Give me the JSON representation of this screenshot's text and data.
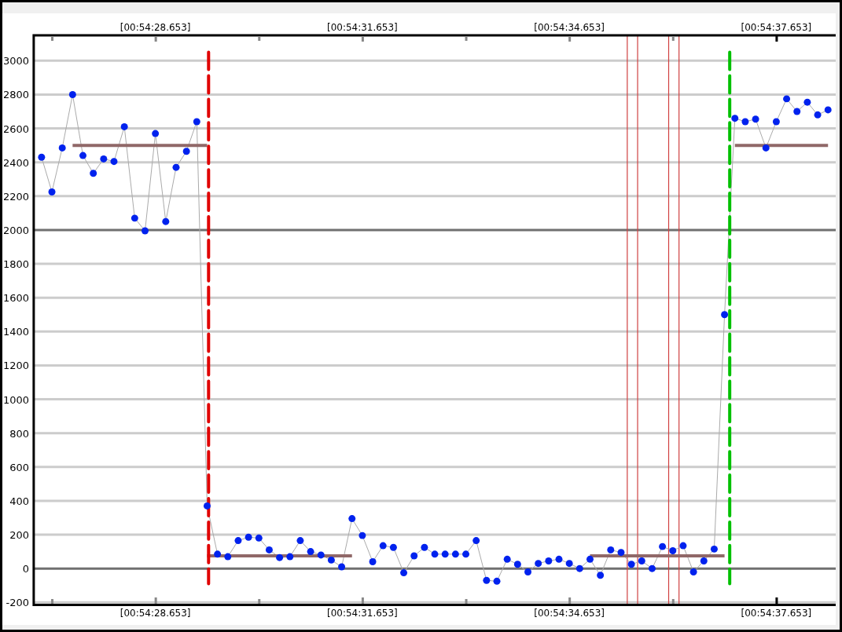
{
  "chart": {
    "top_axis": {
      "labels": [
        "[00:54:28.653]",
        "[00:54:31.653]",
        "[00:54:34.653]",
        "[00:54:37.653]"
      ]
    },
    "chart_data": {
      "type": "line",
      "ylim": [
        -200,
        3150
      ],
      "yticks": [
        -200,
        0,
        200,
        400,
        600,
        800,
        1000,
        1200,
        1400,
        1600,
        1800,
        2000,
        2200,
        2400,
        2600,
        2800,
        3000
      ],
      "categories": [
        null,
        null,
        null,
        null,
        null,
        null,
        null,
        null,
        null,
        null,
        null,
        "[00:54:28.653]",
        null,
        null,
        null,
        null,
        null,
        null,
        null,
        null,
        null,
        null,
        null,
        null,
        null,
        null,
        null,
        null,
        null,
        null,
        null,
        "[00:54:31.653]",
        null,
        null,
        null,
        null,
        null,
        null,
        null,
        null,
        null,
        null,
        null,
        null,
        null,
        null,
        null,
        null,
        null,
        null,
        null,
        "[00:54:34.653]",
        null,
        null,
        null,
        null,
        null,
        null,
        null,
        null,
        null,
        null,
        null,
        null,
        null,
        null,
        null,
        null,
        null,
        null,
        null,
        "[00:54:37.653]",
        null,
        null,
        null,
        null,
        null
      ],
      "grid": true,
      "series": [
        {
          "color": "#906868",
          "values": [
            null,
            null,
            null,
            2500,
            2500,
            2500,
            2500,
            2500,
            2500,
            2500,
            2500,
            2500,
            2500,
            2500,
            2500,
            2500,
            2500,
            null,
            null,
            null,
            null,
            null,
            null,
            null,
            null,
            null,
            null,
            null,
            null,
            null,
            null,
            null,
            null,
            null,
            null,
            null,
            null,
            null,
            null,
            null,
            null,
            null,
            null,
            null,
            null,
            null,
            null,
            null,
            null,
            null,
            null,
            null,
            null,
            null,
            null,
            null,
            null,
            null,
            null,
            null,
            null,
            null,
            null,
            null,
            null,
            null,
            null,
            2500,
            2500,
            2500,
            2500,
            2500,
            2500,
            2500,
            2500,
            2500,
            2500
          ]
        },
        {
          "color": "#906868",
          "values": [
            null,
            null,
            null,
            null,
            null,
            null,
            null,
            null,
            null,
            null,
            null,
            null,
            null,
            null,
            null,
            null,
            75,
            75,
            75,
            75,
            75,
            75,
            75,
            75,
            75,
            75,
            75,
            75,
            75,
            75,
            75,
            null,
            null,
            null,
            null,
            null,
            null,
            null,
            null,
            null,
            null,
            null,
            null,
            null,
            null,
            null,
            null,
            null,
            null,
            null,
            null,
            null,
            null,
            75,
            75,
            75,
            75,
            75,
            75,
            75,
            75,
            75,
            75,
            75,
            75,
            75,
            75,
            null,
            null,
            null,
            null,
            null,
            null,
            null,
            null,
            null,
            null
          ]
        },
        {
          "color": "#0022ee",
          "marker": "circle",
          "values": [
            2430,
            2225,
            2485,
            2800,
            2440,
            2335,
            2420,
            2405,
            2610,
            2070,
            1995,
            2570,
            2050,
            2370,
            2465,
            2640,
            370,
            85,
            70,
            165,
            185,
            180,
            110,
            65,
            70,
            165,
            100,
            80,
            50,
            10,
            295,
            195,
            40,
            135,
            125,
            -25,
            75,
            125,
            85,
            85,
            85,
            85,
            165,
            -70,
            -75,
            55,
            25,
            -20,
            30,
            45,
            55,
            30,
            0,
            55,
            -40,
            110,
            95,
            25,
            45,
            0,
            130,
            105,
            135,
            -20,
            45,
            115,
            1500,
            2660,
            2640,
            2655,
            2485,
            2640,
            2775,
            2700,
            2755,
            2680,
            2710
          ]
        }
      ]
    }
  }
}
